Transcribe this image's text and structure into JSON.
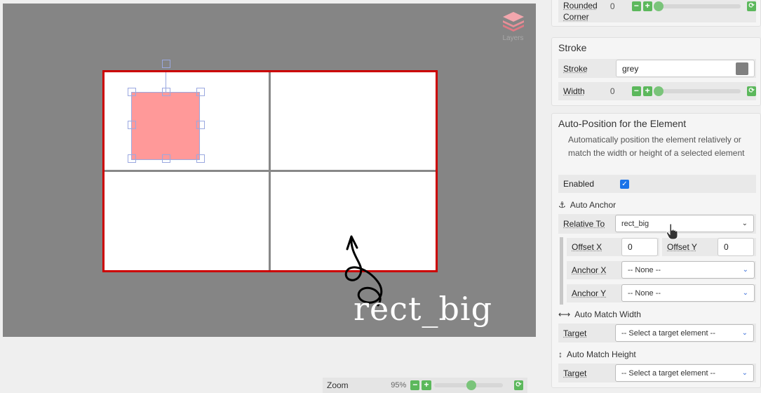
{
  "canvas": {
    "layers_label": "Layers",
    "annotation_text": "rect_big",
    "zoom": {
      "label": "Zoom",
      "value": "95%",
      "level_percent": 95
    }
  },
  "panel": {
    "rounded_corner": {
      "label": "Rounded Corner",
      "value": "0"
    },
    "stroke_section": {
      "title": "Stroke",
      "stroke": {
        "label": "Stroke",
        "value": "grey",
        "swatch": "#808080"
      },
      "width": {
        "label": "Width",
        "value": "0"
      }
    },
    "auto_position": {
      "title": "Auto-Position for the Element",
      "description": "Automatically position the element relatively or match the width or height of a selected element",
      "enabled": {
        "label": "Enabled",
        "checked": true
      },
      "auto_anchor": {
        "title": "Auto Anchor",
        "relative_to": {
          "label": "Relative To",
          "value": "rect_big"
        },
        "offset_x": {
          "label": "Offset X",
          "value": "0"
        },
        "offset_y": {
          "label": "Offset Y",
          "value": "0"
        },
        "anchor_x": {
          "label": "Anchor X",
          "value": "-- None --"
        },
        "anchor_y": {
          "label": "Anchor Y",
          "value": "-- None --"
        }
      },
      "auto_match_width": {
        "title": "Auto Match Width",
        "target": {
          "label": "Target",
          "value": "-- Select a target element --"
        }
      },
      "auto_match_height": {
        "title": "Auto Match Height",
        "target": {
          "label": "Target",
          "value": "-- Select a target element --"
        }
      }
    }
  },
  "colors": {
    "artboard_border": "#cc0000",
    "selected_fill": "#ff9999",
    "accent_green": "#5cb85c",
    "checkbox_blue": "#1a73e8"
  }
}
